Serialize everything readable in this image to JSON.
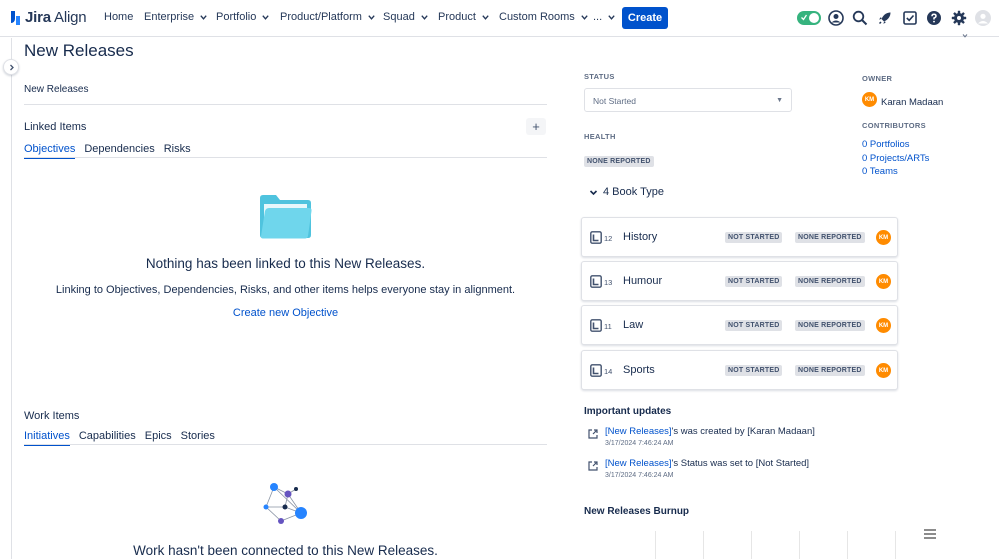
{
  "app": {
    "logo_text_1": "Jira",
    "logo_text_2": " Align"
  },
  "nav": {
    "home": "Home",
    "enterprise": "Enterprise",
    "portfolio": "Portfolio",
    "product_platform": "Product/Platform",
    "squad": "Squad",
    "product": "Product",
    "custom_rooms": "Custom Rooms",
    "more": "...",
    "create": "Create"
  },
  "page": {
    "title": "New Releases",
    "description": "New Releases"
  },
  "linked_items": {
    "title": "Linked Items",
    "add": "+",
    "tabs": [
      "Objectives",
      "Dependencies",
      "Risks"
    ],
    "empty_title": "Nothing has been linked to this New Releases.",
    "empty_sub": "Linking to Objectives, Dependencies, Risks, and other items helps everyone stay in alignment.",
    "empty_link": "Create new Objective"
  },
  "work_items": {
    "title": "Work Items",
    "tabs": [
      "Initiatives",
      "Capabilities",
      "Epics",
      "Stories"
    ],
    "empty_title": "Work hasn't been connected to this New Releases."
  },
  "status": {
    "label": "STATUS",
    "value": "Not Started"
  },
  "health": {
    "label": "HEALTH",
    "value": "NONE REPORTED"
  },
  "owner": {
    "label": "OWNER",
    "initials": "KM",
    "name": "Karan Madaan"
  },
  "contributors": {
    "label": "CONTRIBUTORS",
    "portfolios": "0 Portfolios",
    "projects": "0 Projects/ARTs",
    "teams": "0 Teams"
  },
  "book_type": {
    "header": "4 Book Type",
    "items": [
      {
        "num": "12",
        "name": "History",
        "status": "NOT STARTED",
        "health": "NONE REPORTED",
        "initials": "KM"
      },
      {
        "num": "13",
        "name": "Humour",
        "status": "NOT STARTED",
        "health": "NONE REPORTED",
        "initials": "KM"
      },
      {
        "num": "11",
        "name": "Law",
        "status": "NOT STARTED",
        "health": "NONE REPORTED",
        "initials": "KM"
      },
      {
        "num": "14",
        "name": "Sports",
        "status": "NOT STARTED",
        "health": "NONE REPORTED",
        "initials": "KM"
      }
    ]
  },
  "updates": {
    "title": "Important updates",
    "items": [
      {
        "link": "[New Releases]",
        "text": "'s was created by [Karan Madaan]",
        "time": "3/17/2024 7:46:24 AM"
      },
      {
        "link": "[New Releases]",
        "text": "'s Status was set to [Not Started]",
        "time": "3/17/2024 7:46:24 AM"
      }
    ]
  },
  "burnup": {
    "title": "New Releases Burnup"
  },
  "colors": {
    "primary": "#0052cc",
    "avatar": "#ff8b00",
    "toggle": "#36b37e"
  },
  "icons": [
    "jira-align-logo-icon",
    "chevron-down-icon",
    "toggle-icon",
    "user-circle-icon",
    "search-icon",
    "rocket-icon",
    "checkbox-icon",
    "help-icon",
    "gear-icon",
    "avatar-icon",
    "folder-icon",
    "network-icon",
    "book-icon",
    "update-icon",
    "hamburger-menu-icon"
  ]
}
